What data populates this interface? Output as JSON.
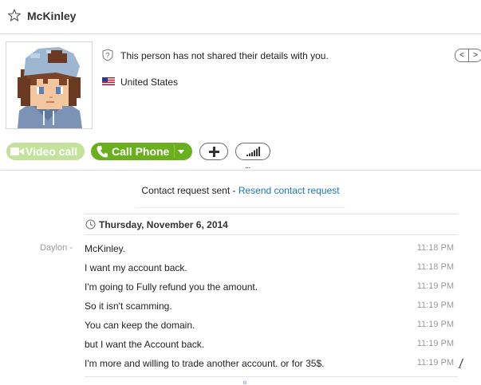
{
  "header": {
    "contact_name": "McKinley",
    "favorite_icon": "star-outline-icon"
  },
  "profile": {
    "avatar": "pixel-art-avatar",
    "privacy_text": "This person has not shared their details with you.",
    "country": "United States",
    "nav_prev": "<",
    "nav_next": ">"
  },
  "call_bar": {
    "video_call_label": "Video call",
    "call_phone_label": "Call Phone",
    "add_icon": "plus-icon",
    "signal_icon": "signal-bars-icon",
    "more": "...",
    "colors": {
      "call_green": "#6aaf1e",
      "video_disabled": "#c4e29b"
    }
  },
  "conversation": {
    "request_text": "Contact request sent - ",
    "resend_link": "Resend contact request",
    "date": "Thursday, November 6, 2014",
    "sender": "Daylon -",
    "messages": [
      {
        "text": "McKinley.",
        "time": "11:18 PM"
      },
      {
        "text": "I want my account back.",
        "time": "11:18 PM"
      },
      {
        "text": "I'm going to Fully refund you the amount.",
        "time": "11:19 PM"
      },
      {
        "text": "So it isn't scamming.",
        "time": "11:19 PM"
      },
      {
        "text": "You can keep the domain.",
        "time": "11:19 PM"
      },
      {
        "text": "but I want the Account back.",
        "time": "11:19 PM"
      },
      {
        "text": "I'm more and willing to trade another account. or for 35$.",
        "time": "11:19 PM"
      }
    ]
  }
}
